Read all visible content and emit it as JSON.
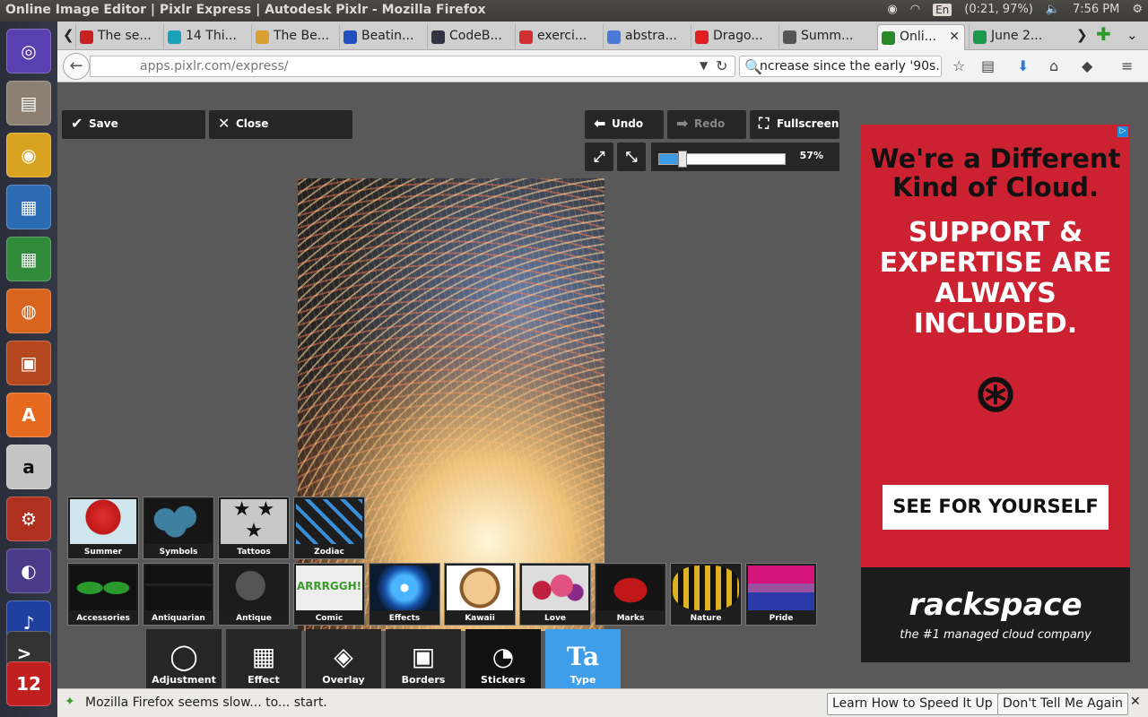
{
  "system": {
    "window_title": "Online Image Editor | Pixlr Express | Autodesk Pixlr - Mozilla Firefox",
    "keyboard": "En",
    "battery": "(0:21, 97%)",
    "time": "7:56 PM"
  },
  "launcher": [
    "ubuntu-dash",
    "files",
    "chrome",
    "writer",
    "calc",
    "firefox",
    "impress",
    "software-center",
    "amazon",
    "settings",
    "eclipse",
    "audacity",
    "terminal",
    "pixlr",
    "workspace"
  ],
  "tabs": [
    "The se...",
    "14 Thi...",
    "The Be...",
    "Beatin...",
    "CodeB...",
    "exerci...",
    "abstra...",
    "Drago...",
    "Summ...",
    "Onli...",
    "June 2..."
  ],
  "tab_colors": [
    "#c82020",
    "#1aa0b8",
    "#d8a030",
    "#2050c0",
    "#333344",
    "#d03030",
    "#4a7ad8",
    "#e02020",
    "#555555",
    "#2a8a2a",
    "#1a9a4a"
  ],
  "address": {
    "url": "apps.pixlr.com/express/",
    "search": "ncrease since the early '90s."
  },
  "editor": {
    "save": "Save",
    "close": "Close",
    "undo": "Undo",
    "redo": "Redo",
    "fullscreen": "Fullscreen",
    "zoom": "57%",
    "zoom_value": 0.57,
    "stickers_row1": [
      "Summer",
      "Symbols",
      "Tattoos",
      "Zodiac"
    ],
    "stickers_row2": [
      "Accessories",
      "Antiquarian",
      "Antique",
      "Comic",
      "Effects",
      "Kawaii",
      "Love",
      "Marks",
      "Nature",
      "Pride"
    ],
    "tools": [
      "Adjustment",
      "Effect",
      "Overlay",
      "Borders",
      "Stickers",
      "Type"
    ]
  },
  "ad": {
    "headline": "We're a Different Kind of Cloud.",
    "body": "SUPPORT & EXPERTISE ARE ALWAYS INCLUDED.",
    "cta": "SEE FOR YOURSELF",
    "brand": "rackspace",
    "tagline": "the #1 managed cloud company"
  },
  "notification": {
    "message": "Mozilla Firefox seems slow... to... start.",
    "learn": "Learn How to Speed It Up",
    "dismiss": "Don't Tell Me Again"
  }
}
